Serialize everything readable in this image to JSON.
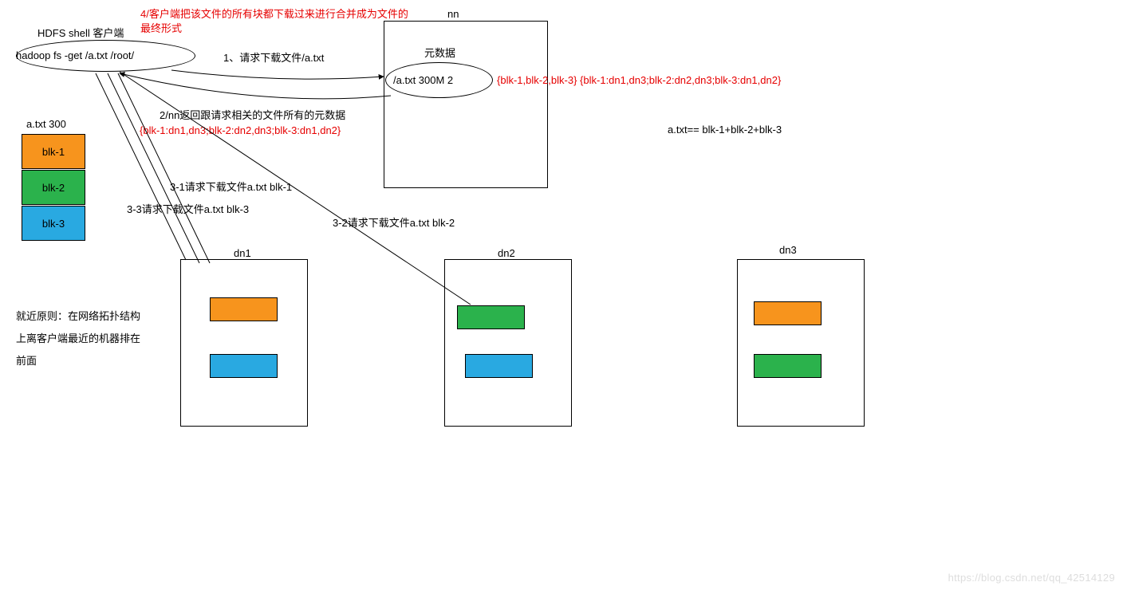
{
  "client": {
    "title": "HDFS shell 客户端",
    "cmd": "hadoop  fs -get    /a.txt   /root/"
  },
  "note_merge_l1": "4/客户端把该文件的所有块都下载过来进行合并成为文件的",
  "note_merge_l2": "最终形式",
  "nn_label": "nn",
  "metadata_title": "元数据",
  "metadata_line": "/a.txt 300M 2",
  "metadata_sets": "{blk-1,blk-2,blk-3}  {blk-1:dn1,dn3;blk-2:dn2,dn3;blk-3:dn1,dn2}",
  "equation": "a.txt==  blk-1+blk-2+blk-3",
  "arrow1": "1、请求下载文件/a.txt",
  "arrow2": "2/nn返回跟请求相关的文件所有的元数据",
  "arrow2_data": "{blk-1:dn1,dn3;blk-2:dn2,dn3;blk-3:dn1,dn2}",
  "req31": "3-1请求下载文件a.txt blk-1",
  "req32": "3-2请求下载文件a.txt blk-2",
  "req33": "3-3请求下载文件a.txt blk-3",
  "file_stack_title": "a.txt  300",
  "blk1": "blk-1",
  "blk2": "blk-2",
  "blk3": "blk-3",
  "dn1": "dn1",
  "dn2": "dn2",
  "dn3": "dn3",
  "proximity_l1": "就近原则：在网络拓扑结构",
  "proximity_l2": "上离客户端最近的机器排在",
  "proximity_l3": "前面",
  "watermark": "https://blog.csdn.net/qq_42514129"
}
